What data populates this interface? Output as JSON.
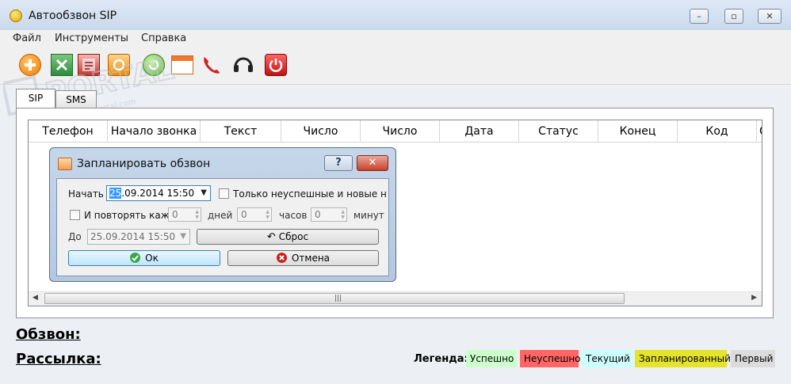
{
  "window": {
    "title": "Автообзвон SIP"
  },
  "menu": [
    "Файл",
    "Инструменты",
    "Справка"
  ],
  "toolbar": [
    "add-icon",
    "excel-icon",
    "report-icon",
    "import-icon",
    "export-icon",
    "calendar-icon",
    "phone-icon",
    "headset-icon",
    "power-icon"
  ],
  "tabs": [
    "SIP",
    "SMS"
  ],
  "grid": {
    "columns": [
      "Телефон",
      "Начало звонка",
      "Текст",
      "Число",
      "Число",
      "Дата",
      "Статус",
      "Конец",
      "Код",
      "С"
    ]
  },
  "dialog": {
    "title": "Запланировать обзвон",
    "help_label": "?",
    "start_label": "Начать",
    "start_value_sel": "25",
    "start_value_rest": ".09.2014 15:50",
    "only_failed_label": "Только неуспешные и новые н",
    "repeat_label": "И повторять каж",
    "days_value": "0",
    "days_label": "дней",
    "hours_value": "0",
    "hours_label": "часов",
    "minutes_value": "0",
    "minutes_label": "минут",
    "until_label": "До",
    "until_value": "25.09.2014 15:50",
    "reset_label": "Сброс",
    "ok_label": "Ок",
    "cancel_label": "Отмена"
  },
  "bottom": {
    "calls_label": "Обзвон:",
    "mailing_label": "Рассылка:"
  },
  "legend": {
    "label": "Легенда:",
    "items": [
      {
        "text": "Успешно",
        "color": "#ccffcc"
      },
      {
        "text": "Неуспешно",
        "color": "#ff6666"
      },
      {
        "text": "Текущий",
        "color": "#ccffff"
      },
      {
        "text": "Запланированный",
        "color": "#e5e32b"
      },
      {
        "text": "Первый",
        "color": "#dcdcdc"
      }
    ]
  },
  "watermark": {
    "brand": "PORTAL",
    "url": "www.softportal.com"
  }
}
